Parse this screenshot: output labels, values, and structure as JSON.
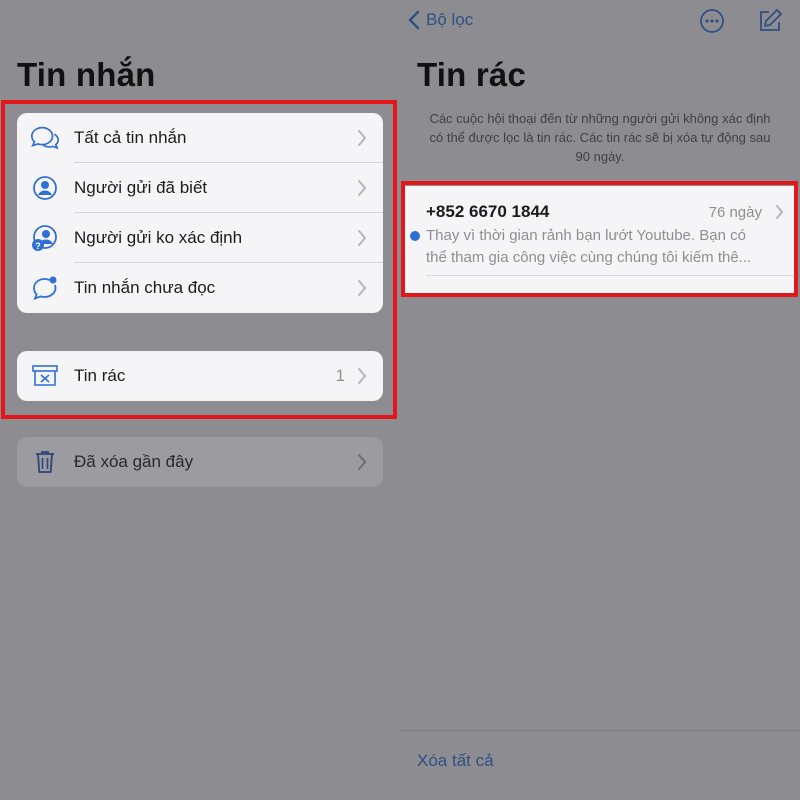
{
  "left": {
    "title": "Tin nhắn",
    "filters": [
      {
        "label": "Tất cả tin nhắn",
        "icon": "chat-bubbles-icon"
      },
      {
        "label": "Người gửi đã biết",
        "icon": "person-circle-icon"
      },
      {
        "label": "Người gửi ko xác định",
        "icon": "unknown-person-icon"
      },
      {
        "label": "Tin nhắn chưa đọc",
        "icon": "unread-bubble-icon"
      }
    ],
    "junk": {
      "label": "Tin rác",
      "count": "1",
      "icon": "junk-tray-icon"
    },
    "recently_deleted": {
      "label": "Đã xóa gần đây",
      "icon": "trash-icon"
    }
  },
  "right": {
    "back_label": "Bộ lọc",
    "title": "Tin rác",
    "description": "Các cuộc hội thoại đến từ những người gửi không xác định có thể được lọc là tin rác. Các tin rác sẽ bị xóa tự động sau 90 ngày.",
    "message": {
      "sender": "+852 6670 1844",
      "time": "76 ngày",
      "preview_line1": "Thay vì thời gian rảnh bạn lướt Youtube.  Bạn có",
      "preview_line2": "thể tham gia công việc cùng chúng tôi   kiếm thê..."
    },
    "delete_all_label": "Xóa tất cả"
  },
  "colors": {
    "accent": "#2f6fd6",
    "highlight": "#e3161b",
    "dimmed_overlay": "#8d8d91"
  }
}
